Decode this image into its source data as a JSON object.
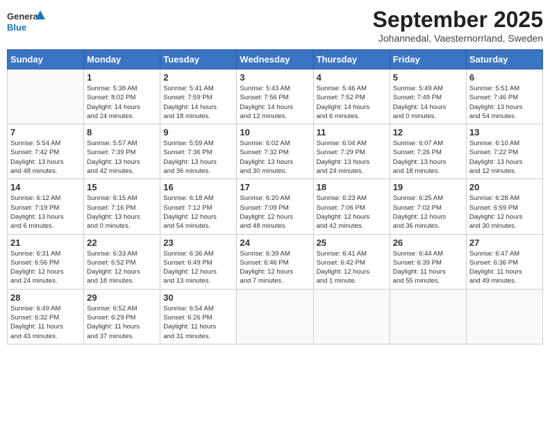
{
  "logo": {
    "general": "General",
    "blue": "Blue"
  },
  "title": "September 2025",
  "location": "Johannedal, Vaesternorrland, Sweden",
  "days_of_week": [
    "Sunday",
    "Monday",
    "Tuesday",
    "Wednesday",
    "Thursday",
    "Friday",
    "Saturday"
  ],
  "weeks": [
    [
      {
        "day": "",
        "info": ""
      },
      {
        "day": "1",
        "info": "Sunrise: 5:38 AM\nSunset: 8:02 PM\nDaylight: 14 hours\nand 24 minutes."
      },
      {
        "day": "2",
        "info": "Sunrise: 5:41 AM\nSunset: 7:59 PM\nDaylight: 14 hours\nand 18 minutes."
      },
      {
        "day": "3",
        "info": "Sunrise: 5:43 AM\nSunset: 7:56 PM\nDaylight: 14 hours\nand 12 minutes."
      },
      {
        "day": "4",
        "info": "Sunrise: 5:46 AM\nSunset: 7:52 PM\nDaylight: 14 hours\nand 6 minutes."
      },
      {
        "day": "5",
        "info": "Sunrise: 5:49 AM\nSunset: 7:49 PM\nDaylight: 14 hours\nand 0 minutes."
      },
      {
        "day": "6",
        "info": "Sunrise: 5:51 AM\nSunset: 7:46 PM\nDaylight: 13 hours\nand 54 minutes."
      }
    ],
    [
      {
        "day": "7",
        "info": "Sunrise: 5:54 AM\nSunset: 7:42 PM\nDaylight: 13 hours\nand 48 minutes."
      },
      {
        "day": "8",
        "info": "Sunrise: 5:57 AM\nSunset: 7:39 PM\nDaylight: 13 hours\nand 42 minutes."
      },
      {
        "day": "9",
        "info": "Sunrise: 5:59 AM\nSunset: 7:36 PM\nDaylight: 13 hours\nand 36 minutes."
      },
      {
        "day": "10",
        "info": "Sunrise: 6:02 AM\nSunset: 7:32 PM\nDaylight: 13 hours\nand 30 minutes."
      },
      {
        "day": "11",
        "info": "Sunrise: 6:04 AM\nSunset: 7:29 PM\nDaylight: 13 hours\nand 24 minutes."
      },
      {
        "day": "12",
        "info": "Sunrise: 6:07 AM\nSunset: 7:26 PM\nDaylight: 13 hours\nand 18 minutes."
      },
      {
        "day": "13",
        "info": "Sunrise: 6:10 AM\nSunset: 7:22 PM\nDaylight: 13 hours\nand 12 minutes."
      }
    ],
    [
      {
        "day": "14",
        "info": "Sunrise: 6:12 AM\nSunset: 7:19 PM\nDaylight: 13 hours\nand 6 minutes."
      },
      {
        "day": "15",
        "info": "Sunrise: 6:15 AM\nSunset: 7:16 PM\nDaylight: 13 hours\nand 0 minutes."
      },
      {
        "day": "16",
        "info": "Sunrise: 6:18 AM\nSunset: 7:12 PM\nDaylight: 12 hours\nand 54 minutes."
      },
      {
        "day": "17",
        "info": "Sunrise: 6:20 AM\nSunset: 7:09 PM\nDaylight: 12 hours\nand 48 minutes."
      },
      {
        "day": "18",
        "info": "Sunrise: 6:23 AM\nSunset: 7:06 PM\nDaylight: 12 hours\nand 42 minutes."
      },
      {
        "day": "19",
        "info": "Sunrise: 6:25 AM\nSunset: 7:02 PM\nDaylight: 12 hours\nand 36 minutes."
      },
      {
        "day": "20",
        "info": "Sunrise: 6:28 AM\nSunset: 6:59 PM\nDaylight: 12 hours\nand 30 minutes."
      }
    ],
    [
      {
        "day": "21",
        "info": "Sunrise: 6:31 AM\nSunset: 6:56 PM\nDaylight: 12 hours\nand 24 minutes."
      },
      {
        "day": "22",
        "info": "Sunrise: 6:33 AM\nSunset: 6:52 PM\nDaylight: 12 hours\nand 18 minutes."
      },
      {
        "day": "23",
        "info": "Sunrise: 6:36 AM\nSunset: 6:49 PM\nDaylight: 12 hours\nand 13 minutes."
      },
      {
        "day": "24",
        "info": "Sunrise: 6:39 AM\nSunset: 6:46 PM\nDaylight: 12 hours\nand 7 minutes."
      },
      {
        "day": "25",
        "info": "Sunrise: 6:41 AM\nSunset: 6:42 PM\nDaylight: 12 hours\nand 1 minute."
      },
      {
        "day": "26",
        "info": "Sunrise: 6:44 AM\nSunset: 6:39 PM\nDaylight: 11 hours\nand 55 minutes."
      },
      {
        "day": "27",
        "info": "Sunrise: 6:47 AM\nSunset: 6:36 PM\nDaylight: 11 hours\nand 49 minutes."
      }
    ],
    [
      {
        "day": "28",
        "info": "Sunrise: 6:49 AM\nSunset: 6:32 PM\nDaylight: 11 hours\nand 43 minutes."
      },
      {
        "day": "29",
        "info": "Sunrise: 6:52 AM\nSunset: 6:29 PM\nDaylight: 11 hours\nand 37 minutes."
      },
      {
        "day": "30",
        "info": "Sunrise: 6:54 AM\nSunset: 6:26 PM\nDaylight: 11 hours\nand 31 minutes."
      },
      {
        "day": "",
        "info": ""
      },
      {
        "day": "",
        "info": ""
      },
      {
        "day": "",
        "info": ""
      },
      {
        "day": "",
        "info": ""
      }
    ]
  ]
}
